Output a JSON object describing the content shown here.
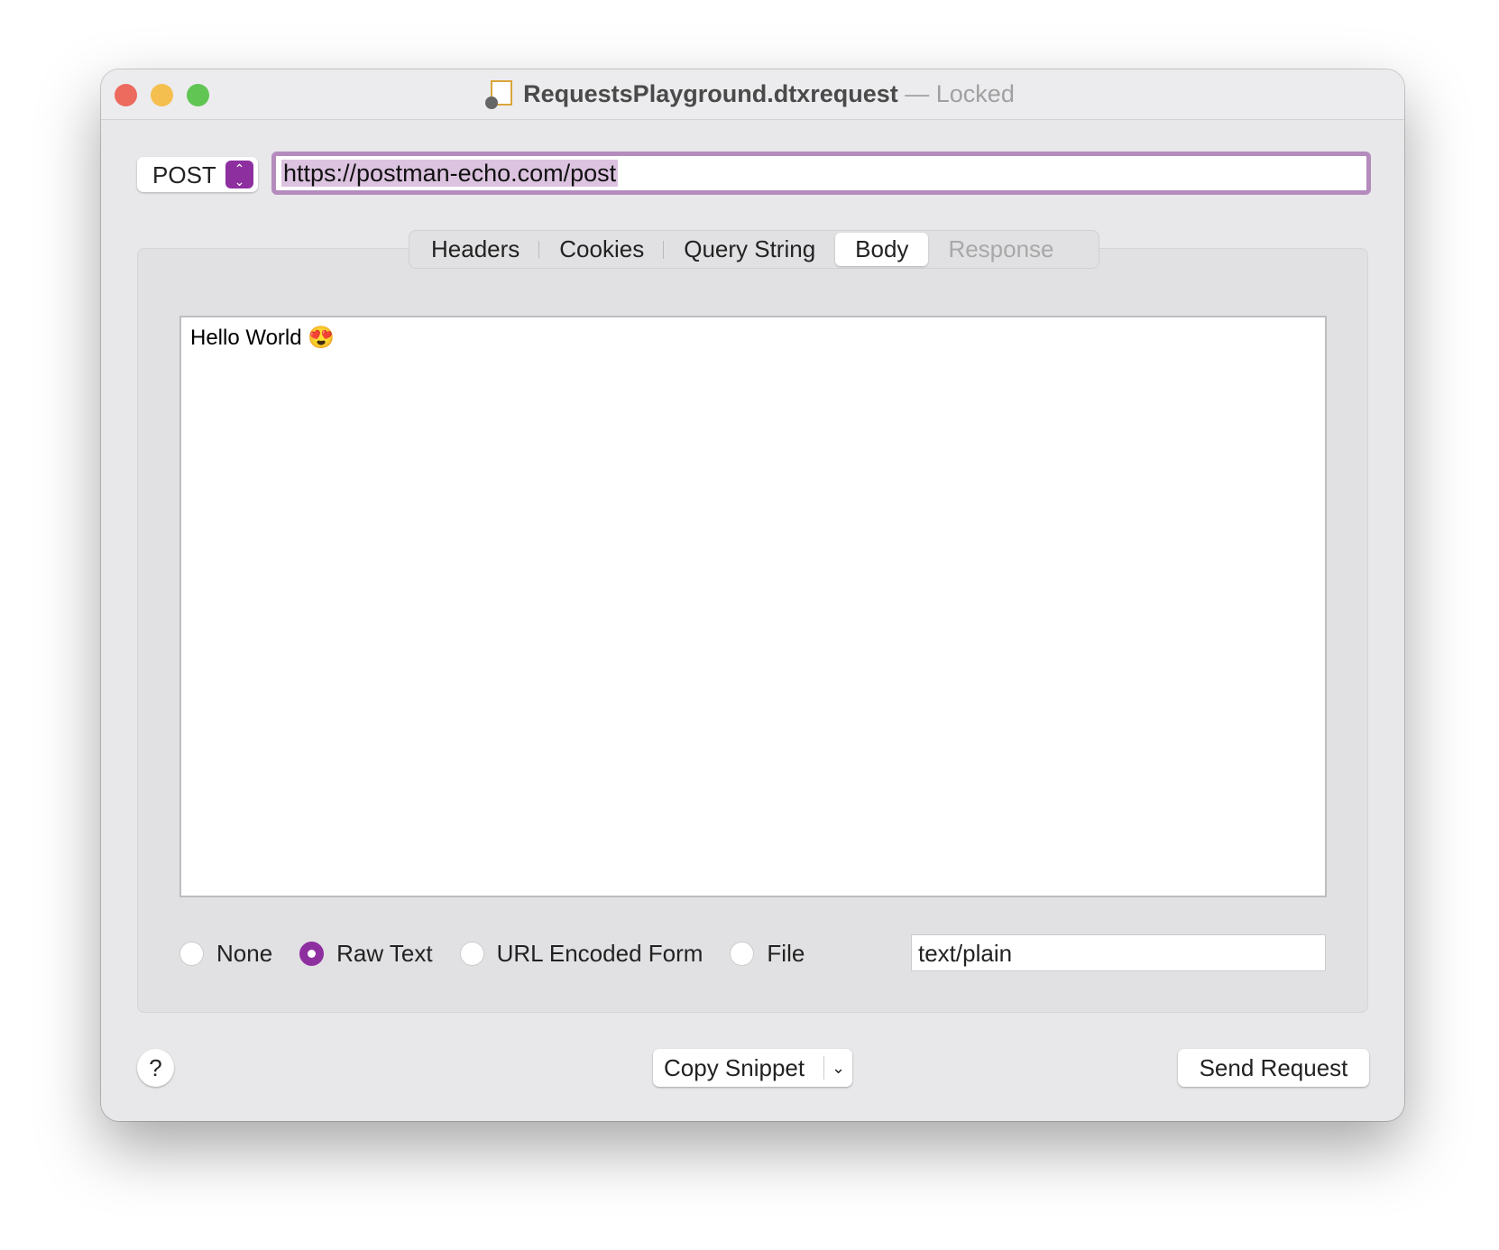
{
  "window": {
    "title": "RequestsPlayground.dtxrequest",
    "separator": "—",
    "status": "Locked",
    "traffic_lights": {
      "close": "#ed6a5e",
      "minimize": "#f5bf4f",
      "zoom": "#61c554"
    }
  },
  "request": {
    "method": "POST",
    "url": "https://postman-echo.com/post"
  },
  "tabs": [
    {
      "label": "Headers",
      "state": "normal"
    },
    {
      "label": "Cookies",
      "state": "normal"
    },
    {
      "label": "Query String",
      "state": "normal"
    },
    {
      "label": "Body",
      "state": "active"
    },
    {
      "label": "Response",
      "state": "disabled"
    }
  ],
  "body": {
    "content": "Hello World 😍",
    "types": [
      {
        "label": "None",
        "selected": false
      },
      {
        "label": "Raw Text",
        "selected": true
      },
      {
        "label": "URL Encoded Form",
        "selected": false
      },
      {
        "label": "File",
        "selected": false
      }
    ],
    "content_type": "text/plain"
  },
  "footer": {
    "help_label": "?",
    "copy_snippet_label": "Copy Snippet",
    "send_label": "Send Request"
  },
  "accent_color": "#8e2fa0"
}
